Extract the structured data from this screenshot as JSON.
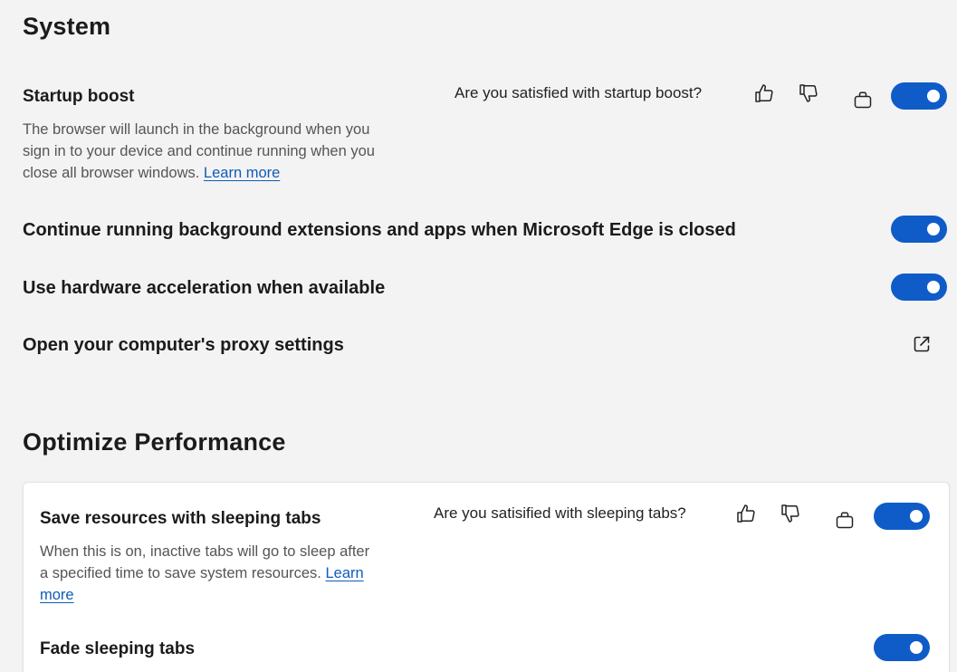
{
  "system": {
    "heading": "System",
    "startup_boost": {
      "title": "Startup boost",
      "desc_line1": "The browser will launch in the background when you",
      "desc_line2": "sign in to your device and continue running when you",
      "desc_line3": "close all browser windows.",
      "learn_more": "Learn more",
      "feedback_question": "Are you satisfied with startup boost?",
      "enabled": true
    },
    "background_extensions": {
      "title": "Continue running background extensions and apps when Microsoft Edge is closed",
      "enabled": true
    },
    "hardware_acceleration": {
      "title": "Use hardware acceleration when available",
      "enabled": true
    },
    "proxy_settings": {
      "title": "Open your computer's proxy settings",
      "icon": "external-link-icon"
    }
  },
  "optimize": {
    "heading": "Optimize Performance",
    "sleeping_tabs": {
      "title": "Save resources with sleeping tabs",
      "desc_line1": "When this is on, inactive tabs will go to sleep after",
      "desc_line2": "a specified time to save system resources.",
      "learn_more_part1": "Learn",
      "learn_more_part2": "more",
      "feedback_question": "Are you satisified with sleeping tabs?",
      "enabled": true
    },
    "fade_sleeping_tabs": {
      "title": "Fade sleeping tabs",
      "enabled": true
    }
  },
  "colors": {
    "toggle_on": "#0f5cc8",
    "link": "#0f5cb8",
    "background": "#f3f3f3",
    "card": "#ffffff"
  }
}
